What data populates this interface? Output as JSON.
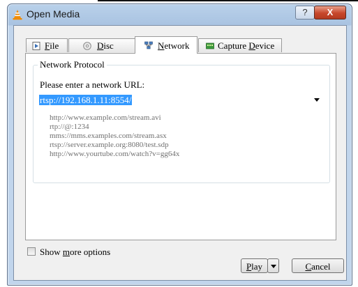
{
  "window": {
    "title": "Open Media",
    "help_label": "?",
    "close_label": "X"
  },
  "tabs": [
    {
      "pre": "",
      "u": "F",
      "post": "ile"
    },
    {
      "pre": "",
      "u": "D",
      "post": "isc"
    },
    {
      "pre": "",
      "u": "N",
      "post": "etwork"
    },
    {
      "pre": "Capture ",
      "u": "D",
      "post": "evice"
    }
  ],
  "network": {
    "group_label": "Network Protocol",
    "prompt": "Please enter a network URL:",
    "url_value": "rtsp://192.168.1.11:8554/",
    "examples": [
      "http://www.example.com/stream.avi",
      "rtp://@:1234",
      "mms://mms.examples.com/stream.asx",
      "rtsp://server.example.org:8080/test.sdp",
      "http://www.yourtube.com/watch?v=gg64x"
    ]
  },
  "options": {
    "pre": "Show ",
    "u": "m",
    "post": "ore options"
  },
  "buttons": {
    "play": {
      "u": "P",
      "post": "lay"
    },
    "cancel": {
      "u": "C",
      "post": "ancel"
    }
  },
  "colors": {
    "selection": "#3399ff",
    "close": "#c7472b",
    "frame": "#b9d1ea"
  }
}
